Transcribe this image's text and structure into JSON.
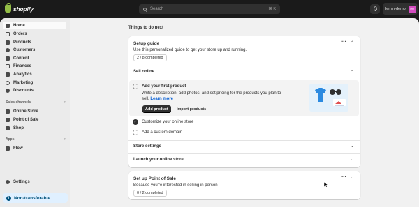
{
  "topbar": {
    "logo_text": "shopify",
    "search_placeholder": "Search",
    "search_shortcut": "⌘ K",
    "store_name": "lemin-demo",
    "store_avatar": "lem"
  },
  "sidebar": {
    "items": [
      {
        "label": "Home",
        "icon": "home-icon",
        "active": true
      },
      {
        "label": "Orders",
        "icon": "orders-icon"
      },
      {
        "label": "Products",
        "icon": "tag-icon"
      },
      {
        "label": "Customers",
        "icon": "person-icon"
      },
      {
        "label": "Content",
        "icon": "content-icon"
      },
      {
        "label": "Finances",
        "icon": "bank-icon"
      },
      {
        "label": "Analytics",
        "icon": "chart-icon"
      },
      {
        "label": "Marketing",
        "icon": "target-icon"
      },
      {
        "label": "Discounts",
        "icon": "discount-icon"
      }
    ],
    "sales_channels_heading": "Sales channels",
    "sales_channels": [
      {
        "label": "Online Store",
        "icon": "store-icon"
      },
      {
        "label": "Point of Sale",
        "icon": "pos-icon"
      },
      {
        "label": "Shop",
        "icon": "shop-icon"
      }
    ],
    "apps_heading": "Apps",
    "apps": [
      {
        "label": "Flow",
        "icon": "flow-icon"
      }
    ],
    "settings_label": "Settings",
    "non_transferable_label": "Non-transferable"
  },
  "main": {
    "things_to_do_title": "Things to do next",
    "setup_guide": {
      "title": "Setup guide",
      "description": "Use this personalized guide to get your store up and running.",
      "progress_text": "2 / 8 completed",
      "sell_online_title": "Sell online",
      "tasks": [
        {
          "title": "Add your first product",
          "description": "Write a description, add photos, and set pricing for the products you plan to sell.",
          "link": "Learn more",
          "primary_button": "Add product",
          "secondary_button": "Import products",
          "status": "incomplete"
        },
        {
          "title": "Customize your online store",
          "status": "complete"
        },
        {
          "title": "Add a custom domain",
          "status": "incomplete"
        }
      ],
      "store_settings_title": "Store settings",
      "launch_store_title": "Launch your online store"
    },
    "point_of_sale": {
      "title": "Set up Point of Sale",
      "description": "Because you're interested in selling in person",
      "progress_text": "0 / 2 completed"
    }
  },
  "colors": {
    "accent_link": "#005bd3",
    "avatar": "#d44dc0",
    "topbar": "#1a1a1a",
    "banner_bg": "#e0f0ff"
  }
}
